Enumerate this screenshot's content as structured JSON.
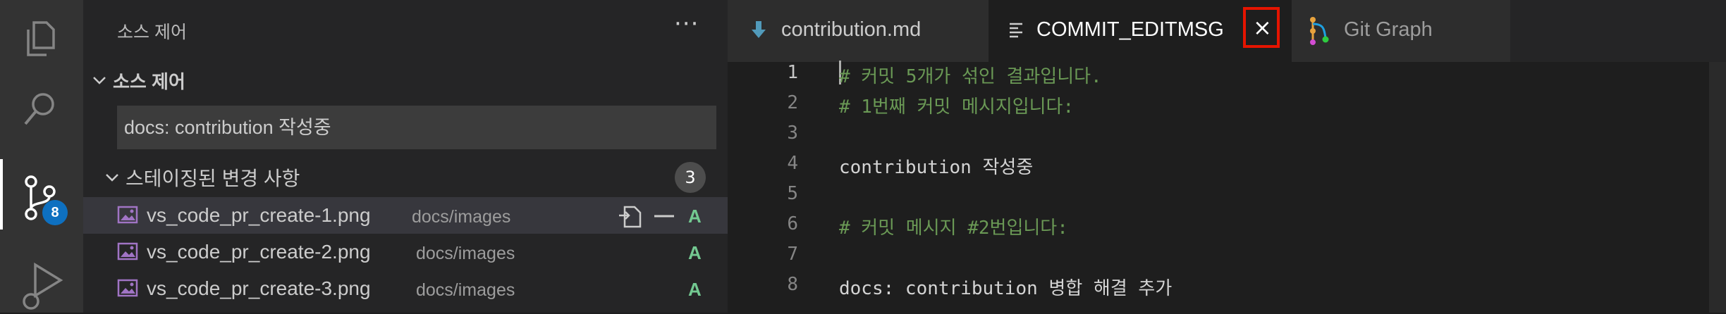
{
  "activity_bar": {
    "items": [
      {
        "name": "explorer",
        "icon": "files-icon"
      },
      {
        "name": "search",
        "icon": "search-icon"
      },
      {
        "name": "source-control",
        "icon": "source-control-icon",
        "badge": "8",
        "active": true
      },
      {
        "name": "run-debug",
        "icon": "run-debug-icon"
      }
    ]
  },
  "sidebar": {
    "title": "소스 제어",
    "more": "···",
    "section_title": "소스 제어",
    "commit_message": "docs: contribution 작성중",
    "staged": {
      "title": "스테이징된 변경 사항",
      "count": "3",
      "files": [
        {
          "name": "vs_code_pr_create-1.png",
          "path": "docs/images",
          "status": "A",
          "selected": true
        },
        {
          "name": "vs_code_pr_create-2.png",
          "path": "docs/images",
          "status": "A"
        },
        {
          "name": "vs_code_pr_create-3.png",
          "path": "docs/images",
          "status": "A"
        }
      ]
    }
  },
  "editor": {
    "tabs": [
      {
        "label": "contribution.md",
        "icon": "markdown-icon"
      },
      {
        "label": "COMMIT_EDITMSG",
        "icon": "text-lines-icon",
        "active": true,
        "close": "×"
      },
      {
        "label": "Git Graph",
        "icon": "git-graph-icon"
      }
    ],
    "lines": [
      {
        "n": "1",
        "text": "# 커밋 5개가 섞인 결과입니다.",
        "kind": "comment"
      },
      {
        "n": "2",
        "text": "# 1번째 커밋 메시지입니다:",
        "kind": "comment"
      },
      {
        "n": "3",
        "text": "",
        "kind": "text"
      },
      {
        "n": "4",
        "text": "contribution 작성중",
        "kind": "text"
      },
      {
        "n": "5",
        "text": "",
        "kind": "text"
      },
      {
        "n": "6",
        "text": "# 커밋 메시지 #2번입니다:",
        "kind": "comment"
      },
      {
        "n": "7",
        "text": "",
        "kind": "text"
      },
      {
        "n": "8",
        "text": "docs: contribution 병합 해결 추가",
        "kind": "text"
      }
    ]
  },
  "colors": {
    "accent_badge": "#0e70c0",
    "added_status": "#73c991",
    "comment": "#6a9955",
    "highlight_box": "#e51400"
  }
}
